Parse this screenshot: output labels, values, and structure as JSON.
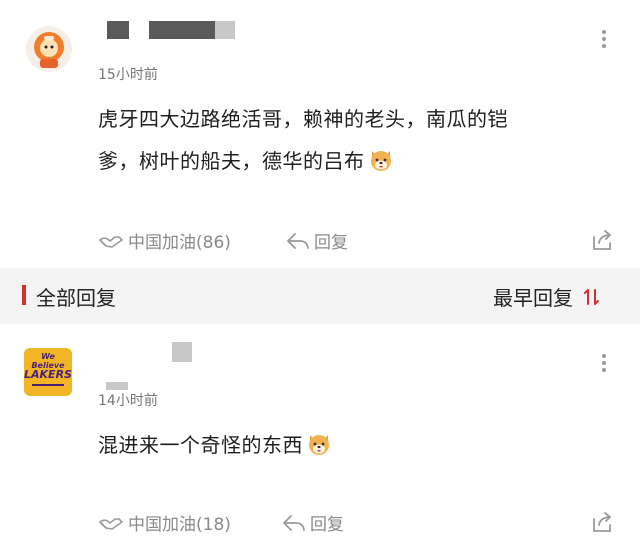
{
  "comment1": {
    "time": "15小时前",
    "text_line1": "虎牙四大边路绝活哥，赖神的老头，南瓜的铠",
    "text_line2": "爹，树叶的船夫，德华的吕布",
    "like_label": "中国加油(86)",
    "reply_label": "回复"
  },
  "section": {
    "all_replies": "全部回复",
    "sort_label": "最早回复",
    "accent": "#d32f2f"
  },
  "comment2": {
    "avatar_text1": "We Believe",
    "avatar_text2": "LAKERS",
    "time": "14小时前",
    "text": "混进来一个奇怪的东西",
    "like_label": "中国加油(18)",
    "reply_label": "回复"
  },
  "icons": {
    "more": "more-vertical-icon",
    "like": "thumbs-up-icon",
    "reply": "reply-arrow-icon",
    "share": "share-icon",
    "emoji": "dog-face-emoji",
    "sort": "sort-arrows-icon"
  }
}
